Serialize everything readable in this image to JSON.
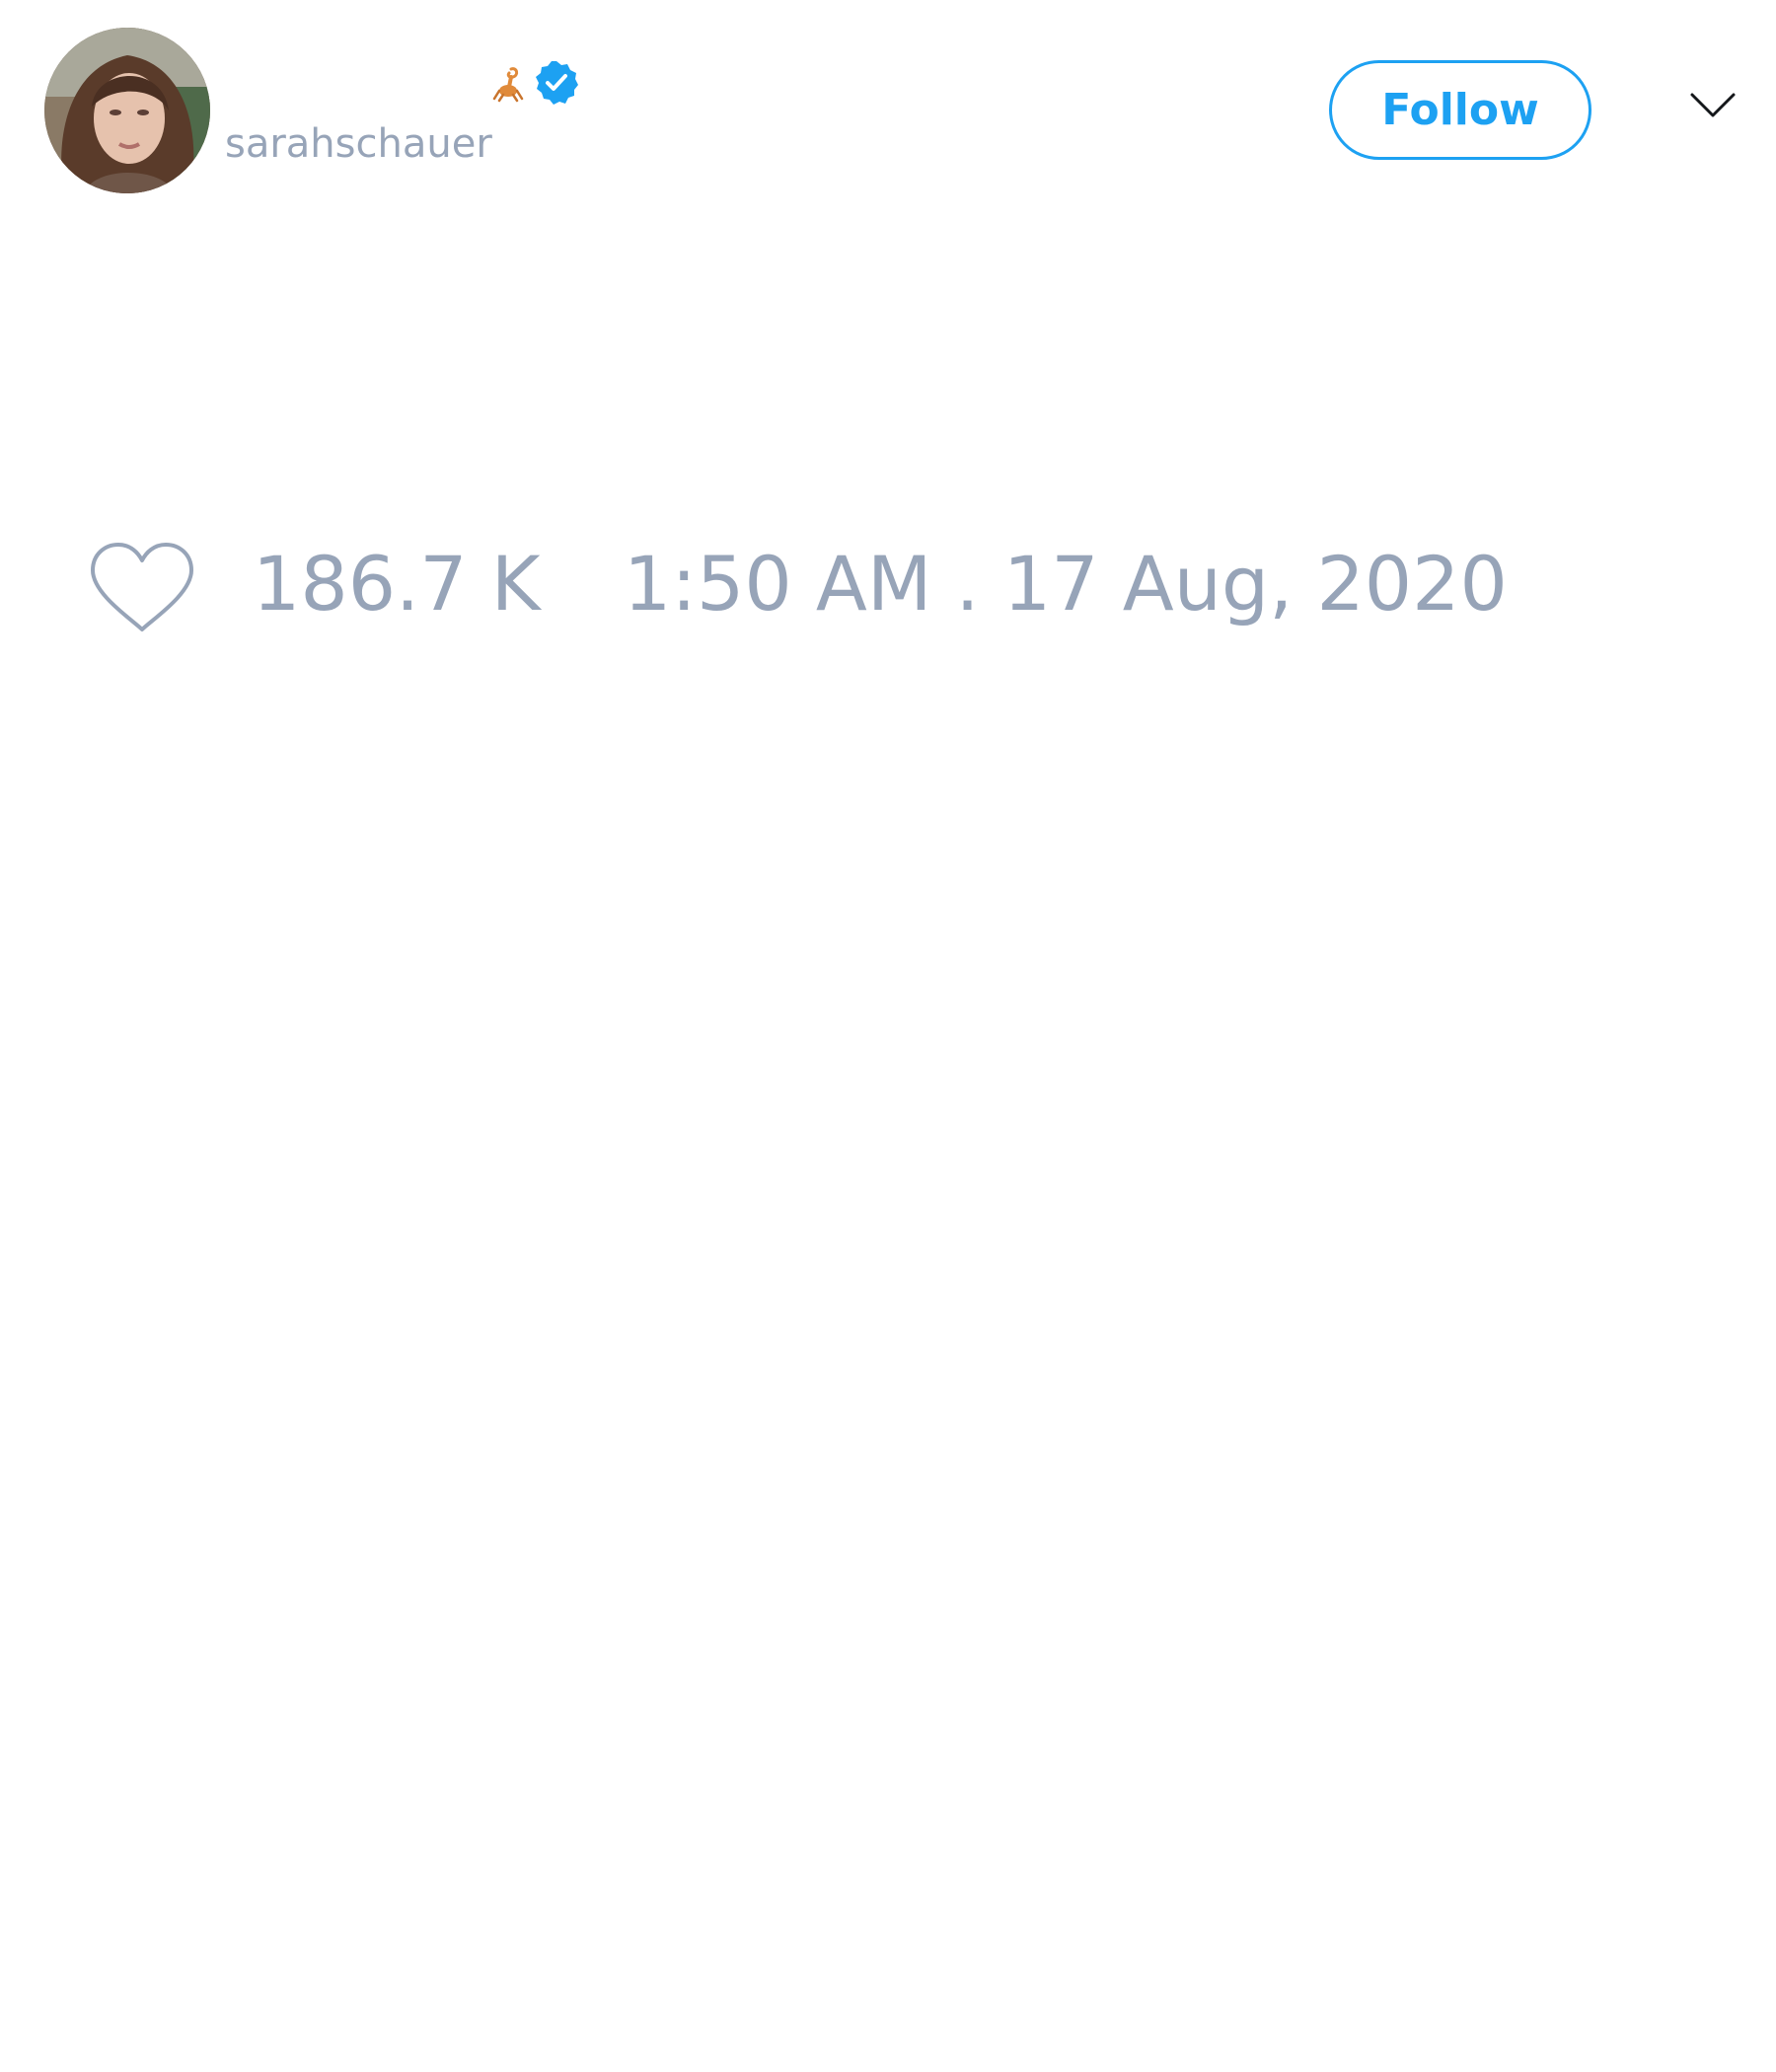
{
  "tweet": {
    "author": {
      "display_name": "",
      "handle": "sarahschauer",
      "emoji_icon": "scorpion-emoji-icon",
      "verified": true,
      "verified_icon": "verified-badge-icon",
      "avatar_icon": "avatar-photo"
    },
    "follow_label": "Follow",
    "menu_icon": "chevron-down-icon",
    "like_icon": "heart-outline-icon",
    "likes": "186.7 K",
    "timestamp": "1:50 AM . 17 Aug, 2020"
  },
  "colors": {
    "accent": "#1da1f2",
    "muted_text": "#97a4b8",
    "background": "#ffffff"
  }
}
